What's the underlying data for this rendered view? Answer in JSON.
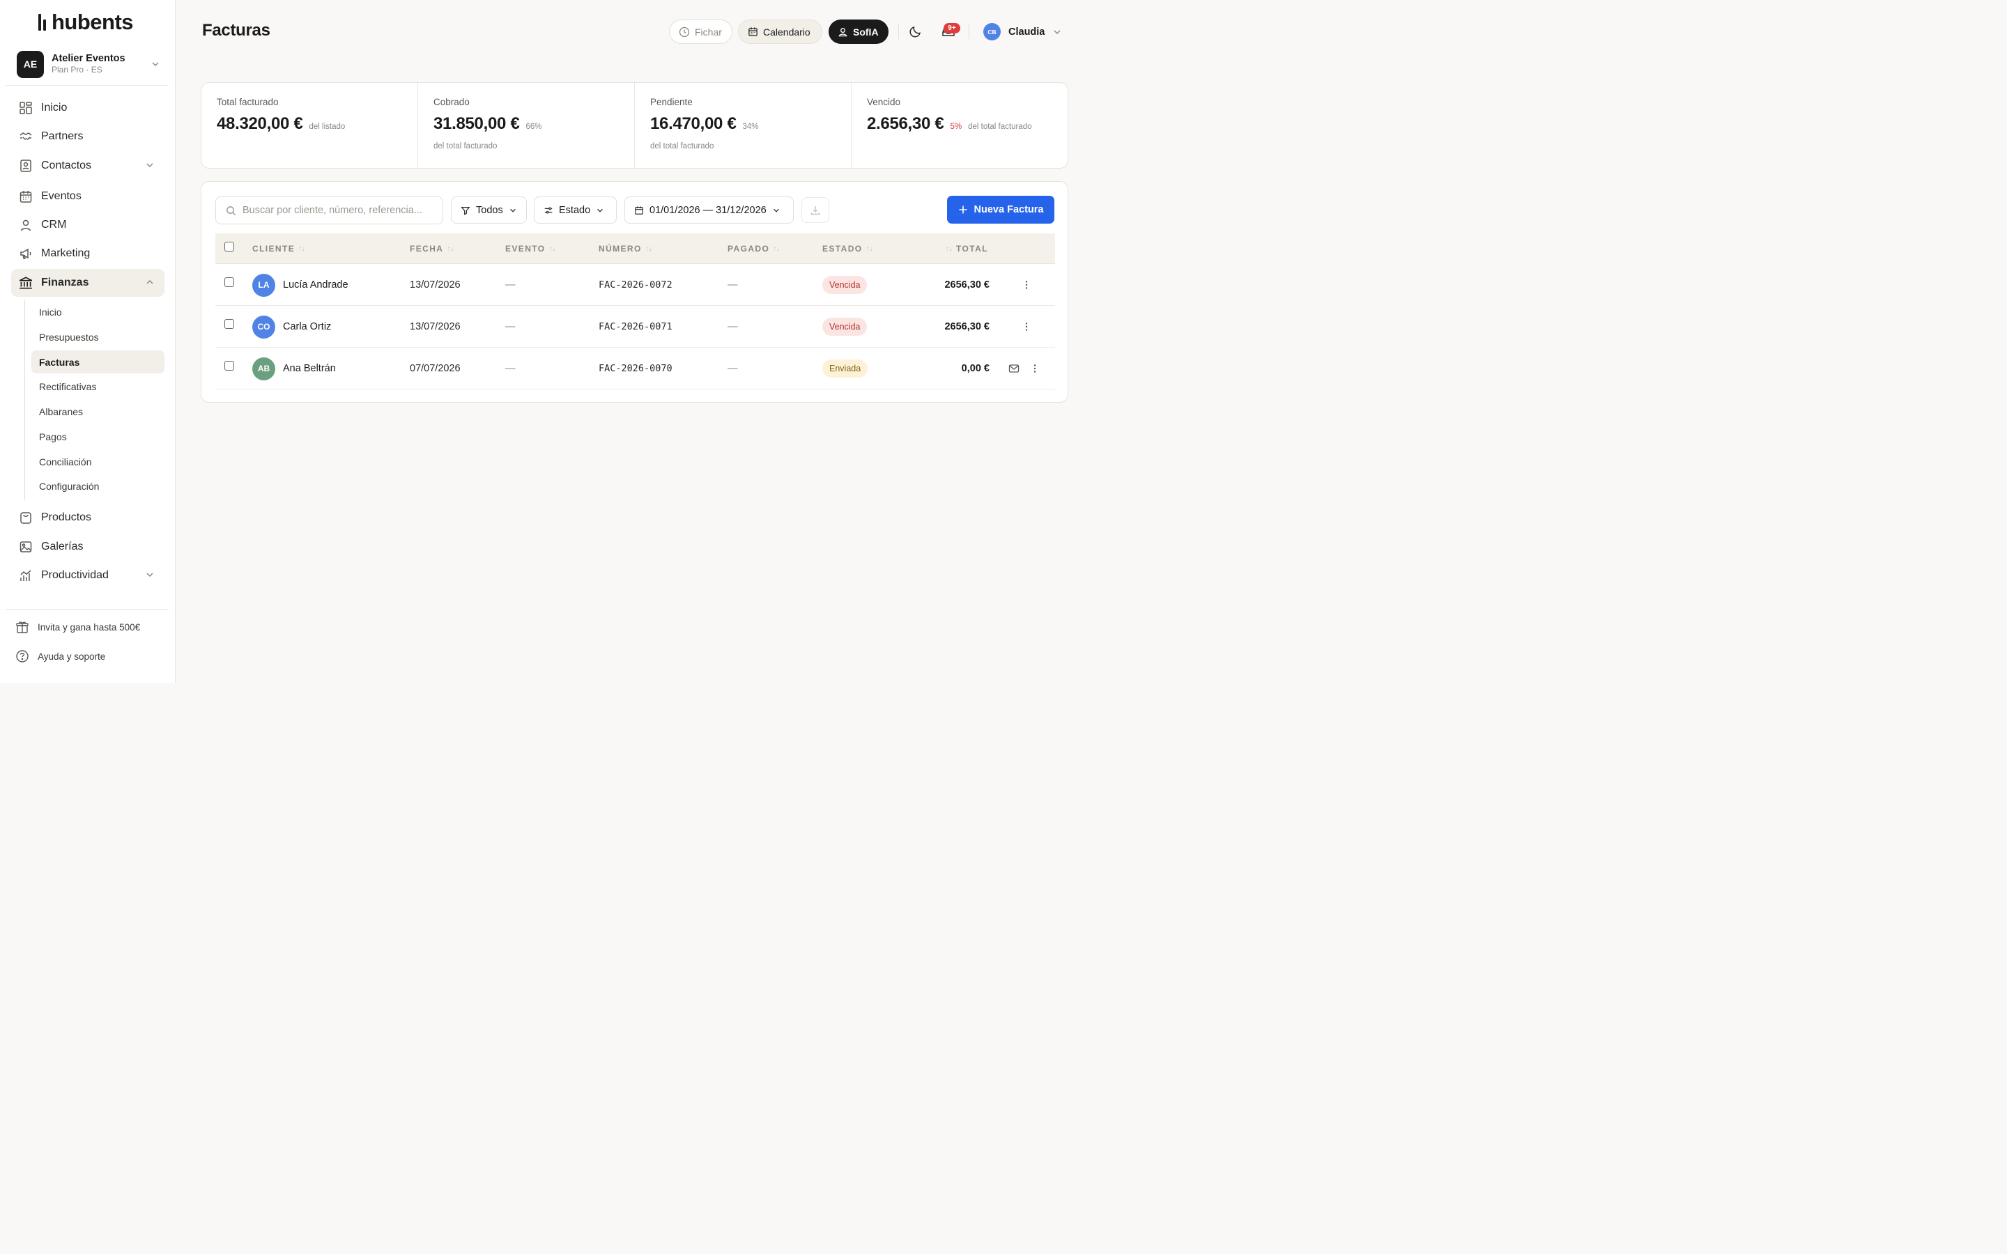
{
  "app": {
    "logo_text": "hubents"
  },
  "workspace": {
    "initials": "AE",
    "name": "Atelier Eventos",
    "plan": "Plan Pro · ES"
  },
  "nav": {
    "inicio": "Inicio",
    "partners": "Partners",
    "contactos": "Contactos",
    "eventos": "Eventos",
    "crm": "CRM",
    "marketing": "Marketing",
    "finanzas": "Finanzas",
    "productos": "Productos",
    "galerias": "Galerías",
    "productividad": "Productividad"
  },
  "subnav": [
    "Inicio",
    "Presupuestos",
    "Facturas",
    "Rectificativas",
    "Albaranes",
    "Pagos",
    "Conciliación",
    "Configuración"
  ],
  "footer": {
    "invite": "Invita y gana hasta 500€",
    "help": "Ayuda y soporte"
  },
  "header": {
    "title": "Facturas",
    "fichar": "Fichar",
    "calendario": "Calendario",
    "sofia": "SofIA",
    "notifications": "9+",
    "user_initials": "CB",
    "user_name": "Claudia"
  },
  "stats": [
    {
      "label": "Total facturado",
      "value": "48.320,00 €",
      "pct": "",
      "note": "del listado",
      "sub": ""
    },
    {
      "label": "Cobrado",
      "value": "31.850,00 €",
      "pct": "66%",
      "note": "",
      "sub": "del total facturado"
    },
    {
      "label": "Pendiente",
      "value": "16.470,00 €",
      "pct": "34%",
      "note": "",
      "sub": "del total facturado"
    },
    {
      "label": "Vencido",
      "value": "2.656,30 €",
      "pct": "5%",
      "note": "del total facturado",
      "sub": ""
    }
  ],
  "toolbar": {
    "search_placeholder": "Buscar por cliente, número, referencia...",
    "filter_all": "Todos",
    "estado": "Estado",
    "date_range": "01/01/2026 — 31/12/2026",
    "new_invoice": "Nueva Factura"
  },
  "table": {
    "headers": {
      "cliente": "CLIENTE",
      "fecha": "FECHA",
      "evento": "EVENTO",
      "numero": "NÚMERO",
      "pagado": "PAGADO",
      "estado": "ESTADO",
      "total": "TOTAL"
    },
    "rows": [
      {
        "initials": "LA",
        "avatar_color": "#4f83e6",
        "cliente": "Lucía Andrade",
        "fecha": "13/07/2026",
        "evento": "—",
        "numero": "FAC-2026-0072",
        "pagado": "—",
        "estado": "Vencida",
        "total": "2656,30 €"
      },
      {
        "initials": "CO",
        "avatar_color": "#4f83e6",
        "cliente": "Carla Ortiz",
        "fecha": "13/07/2026",
        "evento": "—",
        "numero": "FAC-2026-0071",
        "pagado": "—",
        "estado": "Vencida",
        "total": "2656,30 €"
      },
      {
        "initials": "AB",
        "avatar_color": "#6aa07f",
        "cliente": "Ana Beltrán",
        "fecha": "07/07/2026",
        "evento": "—",
        "numero": "FAC-2026-0070",
        "pagado": "—",
        "estado": "Enviada",
        "total": "0,00 €"
      }
    ]
  },
  "colors": {
    "accent": "#2563eb",
    "danger": "#d23b3b",
    "sidebar_active": "#f2eee8"
  }
}
